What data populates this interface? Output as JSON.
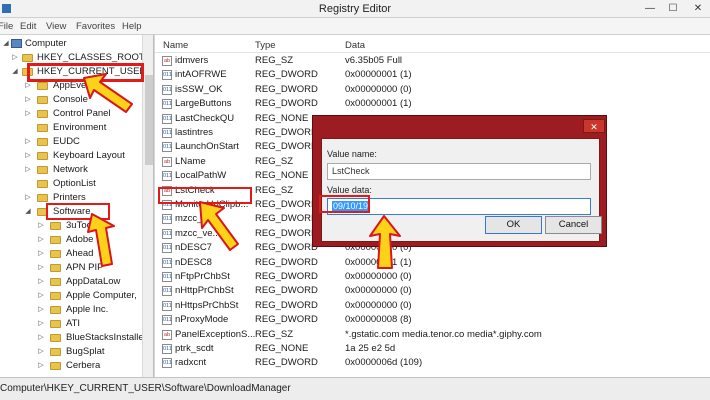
{
  "window": {
    "title": "Registry Editor",
    "minimize": "—",
    "maximize": "☐",
    "close": "✕"
  },
  "menu": [
    "File",
    "Edit",
    "View",
    "Favorites",
    "Help"
  ],
  "tree": {
    "root": "Computer",
    "classes_root": "HKEY_CLASSES_ROOT",
    "current_user": "HKEY_CURRENT_USER",
    "items": [
      "AppEvents",
      "Console",
      "Control Panel",
      "Environment",
      "EUDC",
      "Keyboard Layout",
      "Network",
      "OptionList",
      "Printers",
      "Software"
    ],
    "software_items": [
      "3uTools",
      "Adobe",
      "Ahead",
      "APN PIP",
      "AppDataLow",
      "Apple Computer,",
      "Apple Inc.",
      "ATI",
      "BlueStacksInstaller",
      "BugSplat",
      "Cerbera"
    ]
  },
  "list": {
    "columns": [
      "Name",
      "Type",
      "Data"
    ],
    "rows": [
      {
        "name": "idmvers",
        "type": "REG_SZ",
        "data": "v6.35b05 Full",
        "icon": "string-value-icon"
      },
      {
        "name": "intAOFRWE",
        "type": "REG_DWORD",
        "data": "0x00000001 (1)",
        "icon": "binary-value-icon"
      },
      {
        "name": "isSSW_OK",
        "type": "REG_DWORD",
        "data": "0x00000000 (0)",
        "icon": "binary-value-icon"
      },
      {
        "name": "LargeButtons",
        "type": "REG_DWORD",
        "data": "0x00000001 (1)",
        "icon": "binary-value-icon"
      },
      {
        "name": "LastCheckQU",
        "type": "REG_NONE",
        "data": "",
        "icon": "binary-value-icon"
      },
      {
        "name": "lastintres",
        "type": "REG_DWORD",
        "data": "",
        "icon": "binary-value-icon"
      },
      {
        "name": "LaunchOnStart",
        "type": "REG_DWORD",
        "data": "",
        "icon": "binary-value-icon"
      },
      {
        "name": "LName",
        "type": "REG_SZ",
        "data": "",
        "icon": "string-value-icon"
      },
      {
        "name": "LocalPathW",
        "type": "REG_NONE",
        "data": "",
        "icon": "binary-value-icon"
      },
      {
        "name": "LstCheck",
        "type": "REG_SZ",
        "data": "",
        "icon": "string-value-icon"
      },
      {
        "name": "MonitorUrlClipb...",
        "type": "REG_DWORD",
        "data": "",
        "icon": "binary-value-icon"
      },
      {
        "name": "mzcc_...s",
        "type": "REG_DWORD",
        "data": "",
        "icon": "binary-value-icon"
      },
      {
        "name": "mzcc_ve...",
        "type": "REG_DWORD",
        "data": "",
        "icon": "binary-value-icon"
      },
      {
        "name": "nDESC7",
        "type": "REG_DWORD",
        "data": "0x00000000 (0)",
        "icon": "binary-value-icon"
      },
      {
        "name": "nDESC8",
        "type": "REG_DWORD",
        "data": "0x00000001 (1)",
        "icon": "binary-value-icon"
      },
      {
        "name": "nFtpPrChbSt",
        "type": "REG_DWORD",
        "data": "0x00000000 (0)",
        "icon": "binary-value-icon"
      },
      {
        "name": "nHttpPrChbSt",
        "type": "REG_DWORD",
        "data": "0x00000000 (0)",
        "icon": "binary-value-icon"
      },
      {
        "name": "nHttpsPrChbSt",
        "type": "REG_DWORD",
        "data": "0x00000000 (0)",
        "icon": "binary-value-icon"
      },
      {
        "name": "nProxyMode",
        "type": "REG_DWORD",
        "data": "0x00000008 (8)",
        "icon": "binary-value-icon"
      },
      {
        "name": "PanelExceptionS...",
        "type": "REG_SZ",
        "data": "*.gstatic.com media.tenor.co media*.giphy.com",
        "icon": "string-value-icon"
      },
      {
        "name": "ptrk_scdt",
        "type": "REG_NONE",
        "data": "1a 25 e2 5d",
        "icon": "binary-value-icon"
      },
      {
        "name": "radxcnt",
        "type": "REG_DWORD",
        "data": "0x0000006d (109)",
        "icon": "binary-value-icon"
      }
    ]
  },
  "statusbar": {
    "path": "Computer\\HKEY_CURRENT_USER\\Software\\DownloadManager"
  },
  "dialog": {
    "value_name_label": "Value name:",
    "value_name": "LstCheck",
    "value_data_label": "Value data:",
    "value_data": "09/10/19",
    "ok": "OK",
    "cancel": "Cancel"
  },
  "colors": {
    "highlight": "#e21a1a",
    "arrow_fill": "#ffd21a",
    "dialog_frame": "#9c1c22"
  }
}
